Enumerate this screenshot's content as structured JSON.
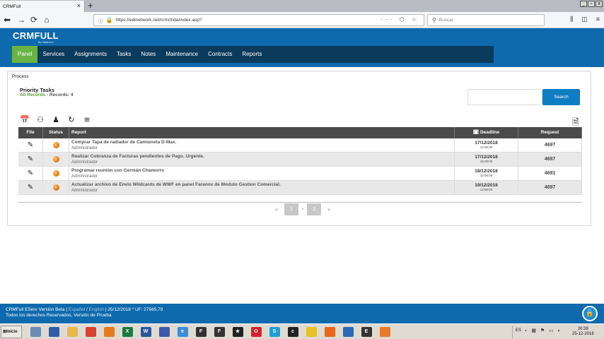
{
  "browser": {
    "tab_title": "CRMFull",
    "tab_close": "×",
    "new_tab": "+",
    "url": "https://edinetwork.net/crm/mda/index.asp?",
    "url_icons": "··· ⬡ ☆",
    "search_placeholder": "Buscar",
    "win_min": "_",
    "win_max": "▫",
    "win_close": "x"
  },
  "app": {
    "logo": "CRMFULL",
    "logo_sub": "By Datatreme",
    "menu": [
      "Panel",
      "Services",
      "Assignments",
      "Tasks",
      "Notes",
      "Maintenance",
      "Contracts",
      "Reports"
    ]
  },
  "panel": {
    "breadcrumb": "Process",
    "title": "Priority Tasks",
    "all_records": "All Records",
    "records_label": " - Records: 4",
    "search_button": "Search"
  },
  "table": {
    "headers": {
      "file": "File",
      "status": "Status",
      "report": "Report",
      "deadline": "Deadline",
      "request": "Request"
    },
    "rows": [
      {
        "title": "Comprar Tapa de radiador de Camioneta D-Max.",
        "owner": "Administrador",
        "date": "17/12/2018",
        "time": "12:00:00",
        "request": "4697"
      },
      {
        "title": "Realizar Cobranza de Facturas pendientes de Pago. Urgente.",
        "owner": "Administrador",
        "date": "17/12/2018",
        "time": "15:00:00",
        "request": "4697"
      },
      {
        "title": "Programar reunión con Germán Chamorro",
        "owner": "Administrador",
        "date": "18/12/2018",
        "time": "12:00:00",
        "request": "4691"
      },
      {
        "title": "Actualizar archivo de Envio Wildcards de WWF en panel Faranox de Modulo Gestion Comercial.",
        "owner": "Administrador",
        "date": "19/12/2018",
        "time": "12:00:00",
        "request": "4697"
      }
    ]
  },
  "pager": {
    "first": "«",
    "last": "»",
    "pages": [
      "1",
      "2"
    ],
    "separator": "-"
  },
  "footer": {
    "version": "CRMFull EServ Versión Beta | ",
    "lang_es": "Español",
    "lang_sep": " / ",
    "lang_en": "English",
    "date_uf": " | 25/12/2018 * UF: 27565,79",
    "rights": "Todos los derechos Reservados, Versión de Prueba"
  },
  "taskbar": {
    "start": "Inicio",
    "lang": "ES",
    "time": "20:39",
    "date": "25-12-2018",
    "apps": [
      {
        "name": "explorer-icon",
        "color": "#6a8bb5",
        "glyph": ""
      },
      {
        "name": "outlook-icon",
        "color": "#2f5ea8",
        "glyph": ""
      },
      {
        "name": "folder-icon",
        "color": "#e8b84a",
        "glyph": ""
      },
      {
        "name": "chrome-icon",
        "color": "#d9432f",
        "glyph": ""
      },
      {
        "name": "office-icon",
        "color": "#e77a1e",
        "glyph": ""
      },
      {
        "name": "excel-icon",
        "color": "#1f7a3e",
        "glyph": "X"
      },
      {
        "name": "word-icon",
        "color": "#2b579a",
        "glyph": "W"
      },
      {
        "name": "network-icon",
        "color": "#3b5aa8",
        "glyph": ""
      },
      {
        "name": "ie-icon",
        "color": "#3a8fd8",
        "glyph": "e"
      },
      {
        "name": "app-f1-icon",
        "color": "#333333",
        "glyph": "F"
      },
      {
        "name": "app-f2-icon",
        "color": "#333333",
        "glyph": "F"
      },
      {
        "name": "star-app-icon",
        "color": "#222222",
        "glyph": "★"
      },
      {
        "name": "opera-icon",
        "color": "#d8202a",
        "glyph": "O"
      },
      {
        "name": "skype-icon",
        "color": "#1e9fdc",
        "glyph": "S"
      },
      {
        "name": "cz-app-icon",
        "color": "#222222",
        "glyph": "c"
      },
      {
        "name": "notes-app-icon",
        "color": "#e8c02a",
        "glyph": ""
      },
      {
        "name": "firefox-icon",
        "color": "#e8661e",
        "glyph": ""
      },
      {
        "name": "sync-app-icon",
        "color": "#2a6ab8",
        "glyph": ""
      },
      {
        "name": "app-e-icon",
        "color": "#333333",
        "glyph": "E"
      },
      {
        "name": "media-app-icon",
        "color": "#e87a2a",
        "glyph": ""
      }
    ]
  }
}
